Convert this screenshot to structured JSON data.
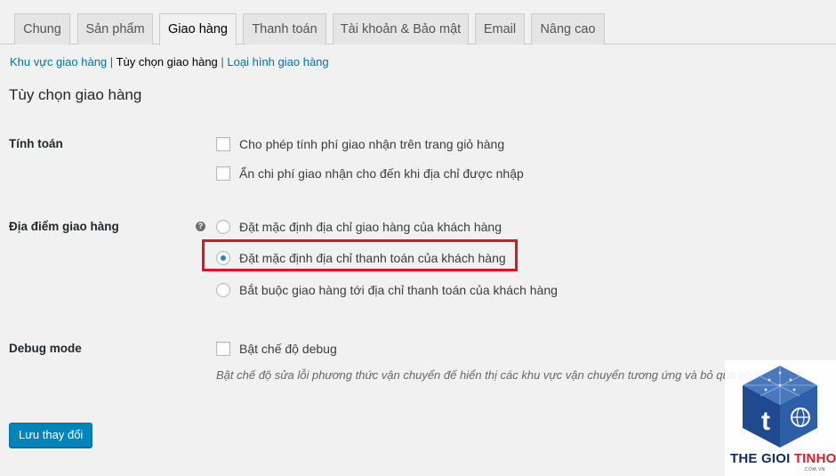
{
  "tabs": [
    {
      "label": "Chung",
      "active": false
    },
    {
      "label": "Sản phẩm",
      "active": false
    },
    {
      "label": "Giao hàng",
      "active": true
    },
    {
      "label": "Thanh toán",
      "active": false
    },
    {
      "label": "Tài khoản & Bảo mật",
      "active": false
    },
    {
      "label": "Email",
      "active": false
    },
    {
      "label": "Nâng cao",
      "active": false
    }
  ],
  "subnav": {
    "zones": "Khu vực giao hàng",
    "options": "Tùy chọn giao hàng",
    "classes": "Loại hình giao hàng",
    "separator": "|"
  },
  "section_title": "Tùy chọn giao hàng",
  "calculations": {
    "label": "Tính toán",
    "options": [
      {
        "label": "Cho phép tính phí giao nhận trên trang giỏ hàng",
        "checked": false
      },
      {
        "label": "Ẩn chi phí giao nhận cho đến khi địa chỉ được nhập",
        "checked": false
      }
    ]
  },
  "destination": {
    "label": "Địa điểm giao hàng",
    "help_glyph": "?",
    "options": [
      {
        "label": "Đặt mặc định địa chỉ giao hàng của khách hàng",
        "checked": false
      },
      {
        "label": "Đặt mặc định địa chỉ thanh toán của khách hàng",
        "checked": true
      },
      {
        "label": "Bắt buộc giao hàng tới địa chỉ thanh toán của khách hàng",
        "checked": false
      }
    ]
  },
  "debug": {
    "label": "Debug mode",
    "option": "Bật chế độ debug",
    "checked": false,
    "description": "Bật chế độ sửa lỗi phương thức vận chuyển để hiển thị các khu vực vận chuyển tương ứng và bỏ qua bộ nhớ đệm."
  },
  "save_button": "Lưu thay đổi",
  "watermark": {
    "letter": "t",
    "name_part1": "THE GIOI ",
    "name_part2": "TINHOC",
    "domain": ".COM.VN"
  },
  "colors": {
    "accent": "#0085ba",
    "link": "#0073aa",
    "highlight": "#e0141e",
    "radio_dot": "#1e8cbe"
  }
}
